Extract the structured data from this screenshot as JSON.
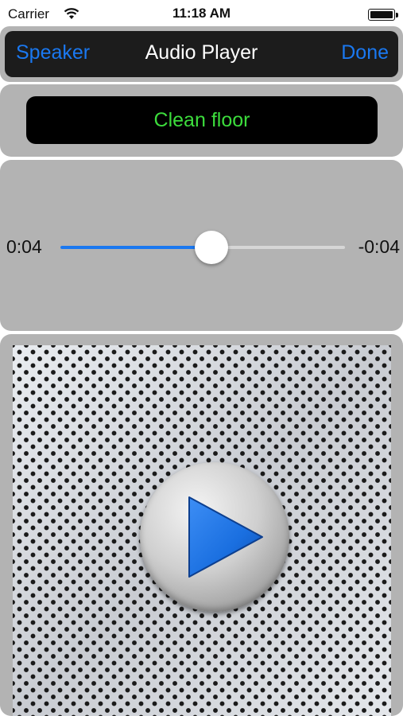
{
  "status_bar": {
    "carrier": "Carrier",
    "time": "11:18 AM",
    "wifi_icon": "wifi-icon",
    "battery_icon": "battery-full-icon"
  },
  "nav": {
    "left_button": "Speaker",
    "title": "Audio Player",
    "right_button": "Done",
    "button_color": "#1a78f0"
  },
  "track": {
    "name": "Clean floor",
    "name_color": "#3cdc3c"
  },
  "playback": {
    "elapsed": "0:04",
    "remaining": "-0:04",
    "progress_fraction": 0.53,
    "accent_color": "#1a78f0"
  },
  "controls": {
    "play_icon": "play-icon",
    "play_color": "#1a6fe0"
  }
}
